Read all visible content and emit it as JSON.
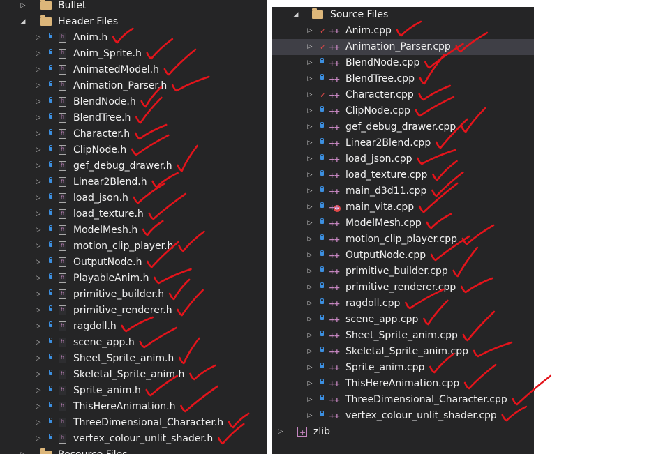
{
  "left_tree": {
    "top_items": [
      {
        "label": "Bullet",
        "expanded": false
      },
      {
        "label": "Header Files",
        "expanded": true
      }
    ],
    "header_files": [
      "Anim.h",
      "Anim_Sprite.h",
      "AnimatedModel.h",
      "Animation_Parser.h",
      "BlendNode.h",
      "BlendTree.h",
      "Character.h",
      "ClipNode.h",
      "gef_debug_drawer.h",
      "Linear2Blend.h",
      "load_json.h",
      "load_texture.h",
      "ModelMesh.h",
      "motion_clip_player.h",
      "OutputNode.h",
      "PlayableAnim.h",
      "primitive_builder.h",
      "primitive_renderer.h",
      "ragdoll.h",
      "scene_app.h",
      "Sheet_Sprite_anim.h",
      "Skeletal_Sprite_anim.h",
      "Sprite_anim.h",
      "ThisHereAnimation.h",
      "ThreeDimensional_Character.h",
      "vertex_colour_unlit_shader.h"
    ],
    "partial_folder": "Resource Files"
  },
  "right_tree": {
    "folder": {
      "label": "Source Files",
      "expanded": true
    },
    "source_files": [
      {
        "label": "Anim.cpp",
        "status": "checked-out"
      },
      {
        "label": "Animation_Parser.cpp",
        "status": "checked-out",
        "selected": true
      },
      {
        "label": "BlendNode.cpp",
        "status": "locked"
      },
      {
        "label": "BlendTree.cpp",
        "status": "locked"
      },
      {
        "label": "Character.cpp",
        "status": "checked-out"
      },
      {
        "label": "ClipNode.cpp",
        "status": "locked"
      },
      {
        "label": "gef_debug_drawer.cpp",
        "status": "locked"
      },
      {
        "label": "Linear2Blend.cpp",
        "status": "locked"
      },
      {
        "label": "load_json.cpp",
        "status": "locked"
      },
      {
        "label": "load_texture.cpp",
        "status": "locked"
      },
      {
        "label": "main_d3d11.cpp",
        "status": "locked"
      },
      {
        "label": "main_vita.cpp",
        "status": "excluded"
      },
      {
        "label": "ModelMesh.cpp",
        "status": "locked"
      },
      {
        "label": "motion_clip_player.cpp",
        "status": "locked"
      },
      {
        "label": "OutputNode.cpp",
        "status": "locked"
      },
      {
        "label": "primitive_builder.cpp",
        "status": "locked"
      },
      {
        "label": "primitive_renderer.cpp",
        "status": "locked"
      },
      {
        "label": "ragdoll.cpp",
        "status": "locked"
      },
      {
        "label": "scene_app.cpp",
        "status": "locked"
      },
      {
        "label": "Sheet_Sprite_anim.cpp",
        "status": "locked"
      },
      {
        "label": "Skeletal_Sprite_anim.cpp",
        "status": "locked"
      },
      {
        "label": "Sprite_anim.cpp",
        "status": "locked"
      },
      {
        "label": "ThisHereAnimation.cpp",
        "status": "locked"
      },
      {
        "label": "ThreeDimensional_Character.cpp",
        "status": "locked"
      },
      {
        "label": "vertex_colour_unlit_shader.cpp",
        "status": "locked"
      }
    ],
    "project": {
      "label": "zlib",
      "expanded": false
    }
  },
  "colors": {
    "panel_background": "#252526",
    "selected_row": "#3f3f46",
    "text": "#f0f0f0",
    "lock_blue": "#3c8fe0",
    "check_red": "#e04848",
    "cpp_purple": "#c586c0",
    "folder_tan": "#dcb67a",
    "annotation_red": "#e3141b"
  }
}
